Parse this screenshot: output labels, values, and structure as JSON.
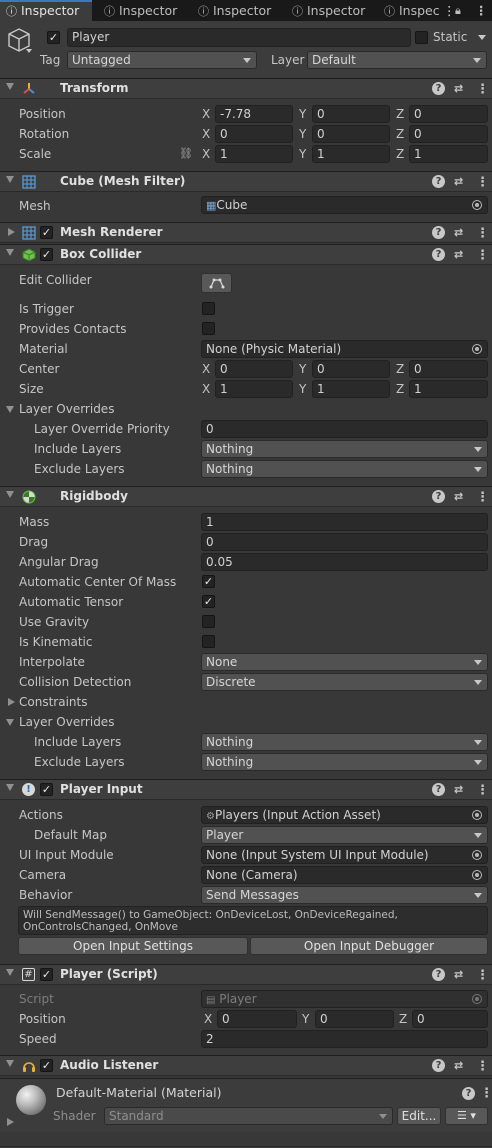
{
  "tabs": [
    "Inspector",
    "Inspector",
    "Inspector",
    "Inspector",
    "Inspec"
  ],
  "object": {
    "name": "Player",
    "static_label": "Static",
    "tag_label": "Tag",
    "tag_value": "Untagged",
    "layer_label": "Layer",
    "layer_value": "Default"
  },
  "transform": {
    "title": "Transform",
    "position_label": "Position",
    "rotation_label": "Rotation",
    "scale_label": "Scale",
    "position": [
      "-7.78",
      "0",
      "0"
    ],
    "rotation": [
      "0",
      "0",
      "0"
    ],
    "scale": [
      "1",
      "1",
      "1"
    ]
  },
  "axes": [
    "X",
    "Y",
    "Z"
  ],
  "mesh_filter": {
    "title": "Cube (Mesh Filter)",
    "mesh_label": "Mesh",
    "mesh_value": "Cube"
  },
  "mesh_renderer": {
    "title": "Mesh Renderer"
  },
  "box_collider": {
    "title": "Box Collider",
    "edit_label": "Edit Collider",
    "is_trigger": "Is Trigger",
    "provides_contacts": "Provides Contacts",
    "material_label": "Material",
    "material_value": "None (Physic Material)",
    "center_label": "Center",
    "center": [
      "0",
      "0",
      "0"
    ],
    "size_label": "Size",
    "size": [
      "1",
      "1",
      "1"
    ],
    "layer_overrides": "Layer Overrides",
    "priority_label": "Layer Override Priority",
    "priority_value": "0",
    "include_label": "Include Layers",
    "include_value": "Nothing",
    "exclude_label": "Exclude Layers",
    "exclude_value": "Nothing"
  },
  "rigidbody": {
    "title": "Rigidbody",
    "mass_label": "Mass",
    "mass": "1",
    "drag_label": "Drag",
    "drag": "0",
    "angular_label": "Angular Drag",
    "angular": "0.05",
    "auto_com": "Automatic Center Of Mass",
    "auto_tensor": "Automatic Tensor",
    "use_gravity": "Use Gravity",
    "is_kinematic": "Is Kinematic",
    "interpolate_label": "Interpolate",
    "interpolate": "None",
    "collision_label": "Collision Detection",
    "collision": "Discrete",
    "constraints": "Constraints",
    "layer_overrides": "Layer Overrides",
    "include_label": "Include Layers",
    "include_value": "Nothing",
    "exclude_label": "Exclude Layers",
    "exclude_value": "Nothing"
  },
  "player_input": {
    "title": "Player Input",
    "actions_label": "Actions",
    "actions_value": "Players (Input Action Asset)",
    "default_map_label": "Default Map",
    "default_map": "Player",
    "ui_module_label": "UI Input Module",
    "ui_module": "None (Input System UI Input Module)",
    "camera_label": "Camera",
    "camera": "None (Camera)",
    "behavior_label": "Behavior",
    "behavior": "Send Messages",
    "help": "Will SendMessage() to GameObject: OnDeviceLost, OnDeviceRegained, OnControlsChanged, OnMove",
    "open_settings": "Open Input Settings",
    "open_debugger": "Open Input Debugger"
  },
  "player_script": {
    "title": "Player (Script)",
    "script_label": "Script",
    "script_value": "Player",
    "position_label": "Position",
    "position": [
      "0",
      "0",
      "0"
    ],
    "speed_label": "Speed",
    "speed": "2"
  },
  "audio_listener": {
    "title": "Audio Listener"
  },
  "material": {
    "title": "Default-Material (Material)",
    "shader_label": "Shader",
    "shader_value": "Standard",
    "edit_label": "Edit..."
  },
  "colors": {
    "accent": "#3a79bb",
    "bg": "#383838",
    "header": "#3e3e3e"
  }
}
